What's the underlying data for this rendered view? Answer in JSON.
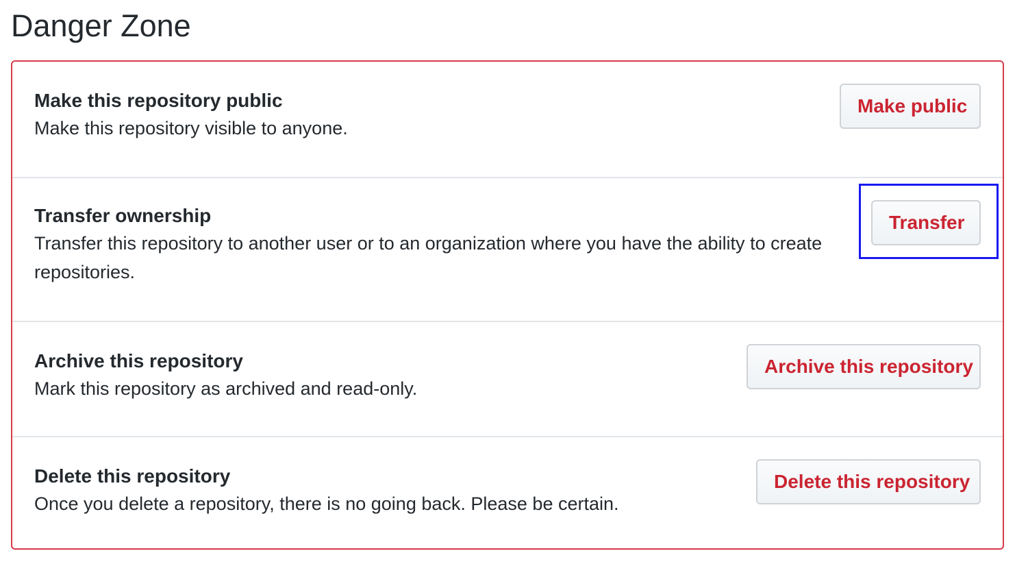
{
  "page": {
    "title": "Danger Zone"
  },
  "colors": {
    "danger_border": "#d73a49",
    "danger_text": "#cb2431",
    "divider": "#e1e4e8",
    "focus_ring": "#1a1af0"
  },
  "rows": [
    {
      "title": "Make this repository public",
      "description": "Make this repository visible to anyone.",
      "button_label": "Make public"
    },
    {
      "title": "Transfer ownership",
      "description": "Transfer this repository to another user or to an organization where you have the ability to create repositories.",
      "button_label": "Transfer",
      "highlighted": true
    },
    {
      "title": "Archive this repository",
      "description": "Mark this repository as archived and read-only.",
      "button_label": "Archive this repository"
    },
    {
      "title": "Delete this repository",
      "description": "Once you delete a repository, there is no going back. Please be certain.",
      "button_label": "Delete this repository"
    }
  ]
}
